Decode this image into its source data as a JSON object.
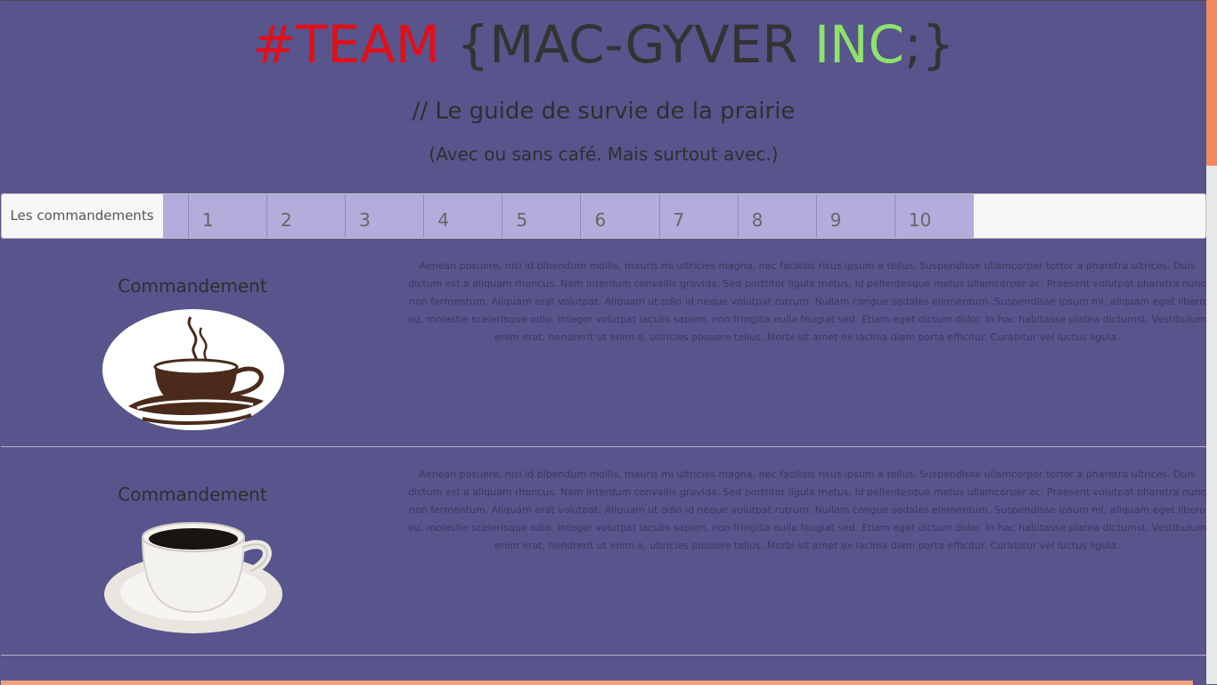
{
  "header": {
    "title_hash": "#TEAM",
    "title_main": "{MAC-GYVER ",
    "title_inc": "INC",
    "title_end": ";}",
    "subtitle": "// Le guide de survie de la prairie",
    "subsubtitle": "(Avec ou sans café. Mais surtout avec.)"
  },
  "nav": {
    "brand": "Les commandements",
    "tabs": [
      "1",
      "2",
      "3",
      "4",
      "5",
      "6",
      "7",
      "8",
      "9",
      "10"
    ]
  },
  "sections": [
    {
      "heading": "Commandement",
      "image": "coffee-cup-illustration-icon",
      "text": "Aenean posuere, nisi id bibendum mollis, mauris mi ultricies magna, nec facilisis risus ipsum a tellus. Suspendisse ullamcorper tortor a pharetra ultrices. Duis dictum est a aliquam rhoncus. Nam interdum convallis gravida. Sed porttitor ligula metus, id pellentesque metus ullamcorper ac. Praesent volutpat pharetra nunc non fermentum. Aliquam erat volutpat. Aliquam ut odio id neque volutpat rutrum. Nullam congue sodales elementum. Suspendisse ipsum mi, aliquam eget libero eu, molestie scelerisque odio. Integer volutpat iaculis sapien, non fringilla nulla feugiat sed. Etiam eget dictum dolor. In hac habitasse platea dictumst. Vestibulum enim erat, hendrerit ut enim a, ultricies posuere tellus. Morbi sit amet ex lacinia diam porta efficitur. Curabitur vel luctus ligula."
    },
    {
      "heading": "Commandement",
      "image": "coffee-cup-photo-icon",
      "text": "Aenean posuere, nisi id bibendum mollis, mauris mi ultricies magna, nec facilisis risus ipsum a tellus. Suspendisse ullamcorper tortor a pharetra ultrices. Duis dictum est a aliquam rhoncus. Nam interdum convallis gravida. Sed porttitor ligula metus, id pellentesque metus ullamcorper ac. Praesent volutpat pharetra nunc non fermentum. Aliquam erat volutpat. Aliquam ut odio id neque volutpat rutrum. Nullam congue sodales elementum. Suspendisse ipsum mi, aliquam eget libero eu, molestie scelerisque odio. Integer volutpat iaculis sapien, non fringilla nulla feugiat sed. Etiam eget dictum dolor. In hac habitasse platea dictumst. Vestibulum enim erat, hendrerit ut enim a, ultricies posuere tellus. Morbi sit amet ex lacinia diam porta efficitur. Curabitur vel luctus ligula."
    }
  ],
  "colors": {
    "background": "#58548c",
    "accent_red": "#e0101a",
    "accent_green": "#8fe26a",
    "tab_bg": "#b2addb",
    "scroll_thumb": "#f08a5e"
  }
}
